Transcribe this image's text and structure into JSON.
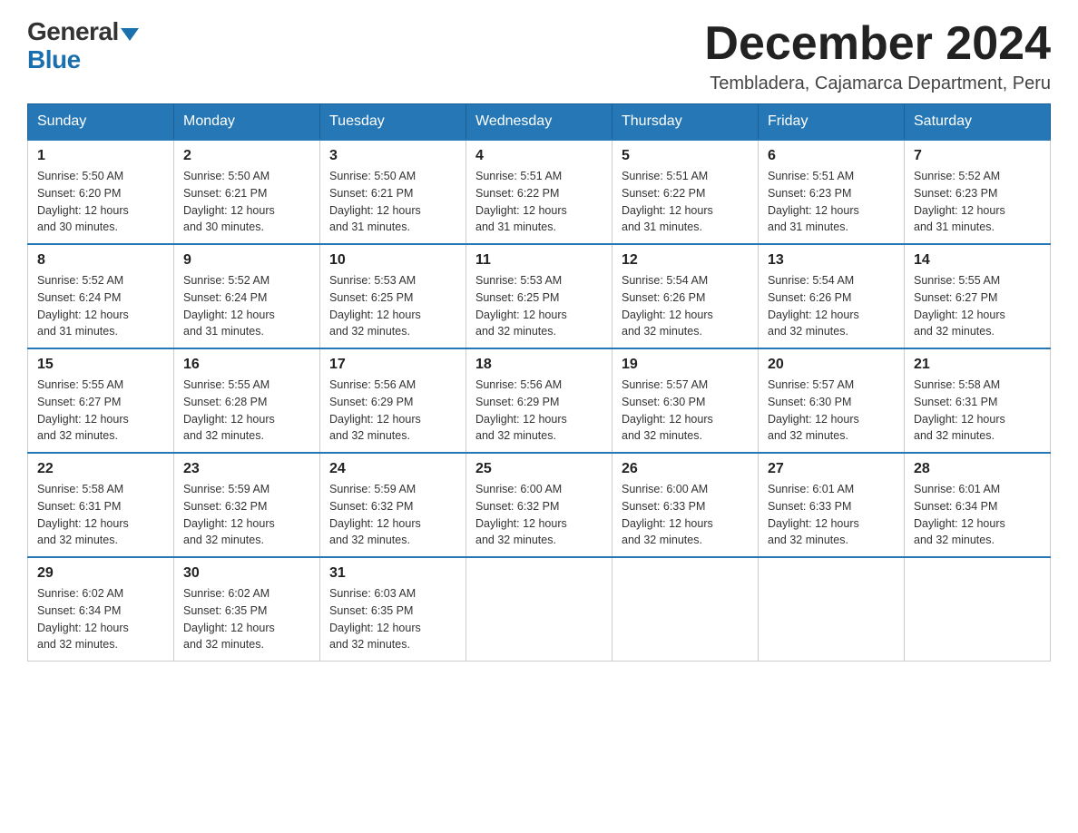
{
  "logo": {
    "general": "General",
    "blue": "Blue",
    "triangle": "▼"
  },
  "title": "December 2024",
  "location": "Tembladera, Cajamarca Department, Peru",
  "days_of_week": [
    "Sunday",
    "Monday",
    "Tuesday",
    "Wednesday",
    "Thursday",
    "Friday",
    "Saturday"
  ],
  "weeks": [
    [
      {
        "day": "1",
        "sunrise": "5:50 AM",
        "sunset": "6:20 PM",
        "daylight": "12 hours and 30 minutes."
      },
      {
        "day": "2",
        "sunrise": "5:50 AM",
        "sunset": "6:21 PM",
        "daylight": "12 hours and 30 minutes."
      },
      {
        "day": "3",
        "sunrise": "5:50 AM",
        "sunset": "6:21 PM",
        "daylight": "12 hours and 31 minutes."
      },
      {
        "day": "4",
        "sunrise": "5:51 AM",
        "sunset": "6:22 PM",
        "daylight": "12 hours and 31 minutes."
      },
      {
        "day": "5",
        "sunrise": "5:51 AM",
        "sunset": "6:22 PM",
        "daylight": "12 hours and 31 minutes."
      },
      {
        "day": "6",
        "sunrise": "5:51 AM",
        "sunset": "6:23 PM",
        "daylight": "12 hours and 31 minutes."
      },
      {
        "day": "7",
        "sunrise": "5:52 AM",
        "sunset": "6:23 PM",
        "daylight": "12 hours and 31 minutes."
      }
    ],
    [
      {
        "day": "8",
        "sunrise": "5:52 AM",
        "sunset": "6:24 PM",
        "daylight": "12 hours and 31 minutes."
      },
      {
        "day": "9",
        "sunrise": "5:52 AM",
        "sunset": "6:24 PM",
        "daylight": "12 hours and 31 minutes."
      },
      {
        "day": "10",
        "sunrise": "5:53 AM",
        "sunset": "6:25 PM",
        "daylight": "12 hours and 32 minutes."
      },
      {
        "day": "11",
        "sunrise": "5:53 AM",
        "sunset": "6:25 PM",
        "daylight": "12 hours and 32 minutes."
      },
      {
        "day": "12",
        "sunrise": "5:54 AM",
        "sunset": "6:26 PM",
        "daylight": "12 hours and 32 minutes."
      },
      {
        "day": "13",
        "sunrise": "5:54 AM",
        "sunset": "6:26 PM",
        "daylight": "12 hours and 32 minutes."
      },
      {
        "day": "14",
        "sunrise": "5:55 AM",
        "sunset": "6:27 PM",
        "daylight": "12 hours and 32 minutes."
      }
    ],
    [
      {
        "day": "15",
        "sunrise": "5:55 AM",
        "sunset": "6:27 PM",
        "daylight": "12 hours and 32 minutes."
      },
      {
        "day": "16",
        "sunrise": "5:55 AM",
        "sunset": "6:28 PM",
        "daylight": "12 hours and 32 minutes."
      },
      {
        "day": "17",
        "sunrise": "5:56 AM",
        "sunset": "6:29 PM",
        "daylight": "12 hours and 32 minutes."
      },
      {
        "day": "18",
        "sunrise": "5:56 AM",
        "sunset": "6:29 PM",
        "daylight": "12 hours and 32 minutes."
      },
      {
        "day": "19",
        "sunrise": "5:57 AM",
        "sunset": "6:30 PM",
        "daylight": "12 hours and 32 minutes."
      },
      {
        "day": "20",
        "sunrise": "5:57 AM",
        "sunset": "6:30 PM",
        "daylight": "12 hours and 32 minutes."
      },
      {
        "day": "21",
        "sunrise": "5:58 AM",
        "sunset": "6:31 PM",
        "daylight": "12 hours and 32 minutes."
      }
    ],
    [
      {
        "day": "22",
        "sunrise": "5:58 AM",
        "sunset": "6:31 PM",
        "daylight": "12 hours and 32 minutes."
      },
      {
        "day": "23",
        "sunrise": "5:59 AM",
        "sunset": "6:32 PM",
        "daylight": "12 hours and 32 minutes."
      },
      {
        "day": "24",
        "sunrise": "5:59 AM",
        "sunset": "6:32 PM",
        "daylight": "12 hours and 32 minutes."
      },
      {
        "day": "25",
        "sunrise": "6:00 AM",
        "sunset": "6:32 PM",
        "daylight": "12 hours and 32 minutes."
      },
      {
        "day": "26",
        "sunrise": "6:00 AM",
        "sunset": "6:33 PM",
        "daylight": "12 hours and 32 minutes."
      },
      {
        "day": "27",
        "sunrise": "6:01 AM",
        "sunset": "6:33 PM",
        "daylight": "12 hours and 32 minutes."
      },
      {
        "day": "28",
        "sunrise": "6:01 AM",
        "sunset": "6:34 PM",
        "daylight": "12 hours and 32 minutes."
      }
    ],
    [
      {
        "day": "29",
        "sunrise": "6:02 AM",
        "sunset": "6:34 PM",
        "daylight": "12 hours and 32 minutes."
      },
      {
        "day": "30",
        "sunrise": "6:02 AM",
        "sunset": "6:35 PM",
        "daylight": "12 hours and 32 minutes."
      },
      {
        "day": "31",
        "sunrise": "6:03 AM",
        "sunset": "6:35 PM",
        "daylight": "12 hours and 32 minutes."
      },
      null,
      null,
      null,
      null
    ]
  ],
  "labels": {
    "sunrise": "Sunrise:",
    "sunset": "Sunset:",
    "daylight": "Daylight:"
  }
}
